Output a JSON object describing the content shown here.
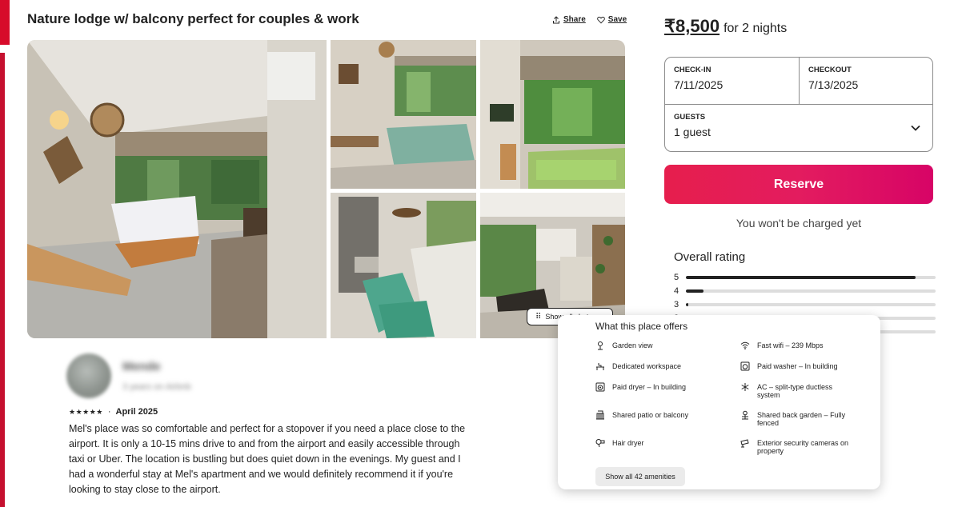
{
  "listing": {
    "title": "Nature lodge w/ balcony perfect for couples & work",
    "share_label": "Share",
    "save_label": "Save"
  },
  "gallery": {
    "show_all_photos_label": "Show all photos"
  },
  "review": {
    "reviewer_name": "Mende",
    "reviewer_sub": "3 years on Airbnb",
    "stars": "★★★★★",
    "date": "April 2025",
    "text": "Mel's place was so comfortable and perfect for a stopover if you need a place close to the airport. It is only a 10-15 mins drive to and from the airport and easily accessible through taxi or Uber. The location is bustling but does quiet  down in the evenings. My guest and I had a wonderful stay at Mel's apartment and we would definitely recommend it if you're looking to stay close to the airport."
  },
  "booking": {
    "price": "₹8,500",
    "price_note": "for 2 nights",
    "checkin_label": "CHECK-IN",
    "checkin_value": "7/11/2025",
    "checkout_label": "CHECKOUT",
    "checkout_value": "7/13/2025",
    "guests_label": "GUESTS",
    "guests_value": "1 guest",
    "reserve_label": "Reserve",
    "charge_note": "You won't be charged yet"
  },
  "overall_rating": {
    "title": "Overall rating",
    "rows": [
      {
        "stars": "5",
        "fraction": 0.92
      },
      {
        "stars": "4",
        "fraction": 0.07
      },
      {
        "stars": "3",
        "fraction": 0.01
      },
      {
        "stars": "2",
        "fraction": 0.0
      },
      {
        "stars": "1",
        "fraction": 0.0
      }
    ]
  },
  "amenities": {
    "title": "What this place offers",
    "items": [
      {
        "label": "Garden view",
        "icon": "garden-icon"
      },
      {
        "label": "Fast wifi – 239 Mbps",
        "icon": "wifi-icon"
      },
      {
        "label": "Dedicated workspace",
        "icon": "workspace-icon"
      },
      {
        "label": "Paid washer – In building",
        "icon": "washer-icon"
      },
      {
        "label": "Paid dryer – In building",
        "icon": "dryer-icon"
      },
      {
        "label": "AC – split-type ductless system",
        "icon": "snowflake-icon"
      },
      {
        "label": "Shared patio or balcony",
        "icon": "patio-icon"
      },
      {
        "label": "Shared back garden – Fully fenced",
        "icon": "garden-fence-icon"
      },
      {
        "label": "Hair dryer",
        "icon": "hair-dryer-icon"
      },
      {
        "label": "Exterior security cameras on property",
        "icon": "camera-icon"
      }
    ],
    "show_all_label": "Show all 42 amenities"
  },
  "colors": {
    "brand": "#e31c5f",
    "accent_bar": "#d70b2a"
  }
}
